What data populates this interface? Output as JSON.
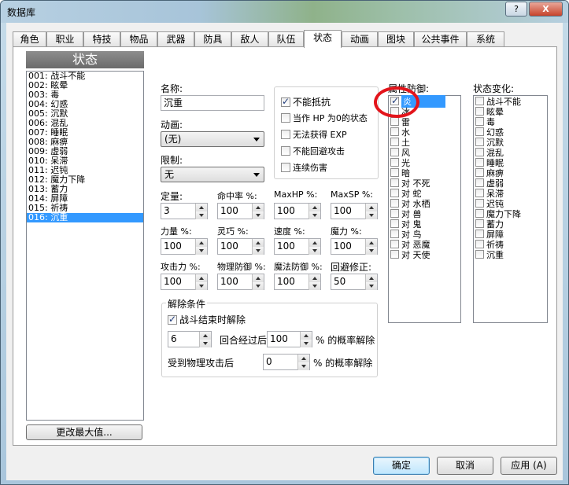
{
  "window": {
    "title": "数据库",
    "help_label": "?",
    "close_label": "X"
  },
  "tabs": [
    "角色",
    "职业",
    "特技",
    "物品",
    "武器",
    "防具",
    "敌人",
    "队伍",
    "状态",
    "动画",
    "图块",
    "公共事件",
    "系统"
  ],
  "active_tab": "状态",
  "left": {
    "header": "状态",
    "items": [
      "001: 战斗不能",
      "002: 眩晕",
      "003: 毒",
      "004: 幻惑",
      "005: 沉默",
      "006: 混乱",
      "007: 睡眠",
      "008: 麻痹",
      "009: 虚弱",
      "010: 呆滞",
      "011: 迟钝",
      "012: 魔力下降",
      "013: 蓄力",
      "014: 屏障",
      "015: 祈祷",
      "016: 沉重"
    ],
    "selected_index": 15,
    "change_max_label": "更改最大值..."
  },
  "form": {
    "name_label": "名称:",
    "name_value": "沉重",
    "animation_label": "动画:",
    "animation_value": "(无)",
    "restriction_label": "限制:",
    "restriction_value": "无",
    "fields": [
      {
        "label": "定量:",
        "value": "3"
      },
      {
        "label": "命中率 %:",
        "value": "100"
      },
      {
        "label": "MaxHP %:",
        "value": "100"
      },
      {
        "label": "MaxSP %:",
        "value": "100"
      },
      {
        "label": "力量 %:",
        "value": "100"
      },
      {
        "label": "灵巧 %:",
        "value": "100"
      },
      {
        "label": "速度 %:",
        "value": "100"
      },
      {
        "label": "魔力 %:",
        "value": "100"
      },
      {
        "label": "攻击力 %:",
        "value": "100"
      },
      {
        "label": "物理防御 %:",
        "value": "100"
      },
      {
        "label": "魔法防御 %:",
        "value": "100"
      },
      {
        "label": "回避修正:",
        "value": "50"
      }
    ],
    "options": [
      {
        "label": "不能抵抗",
        "checked": true
      },
      {
        "label": "当作 HP 为0的状态",
        "checked": false
      },
      {
        "label": "无法获得 EXP",
        "checked": false
      },
      {
        "label": "不能回避攻击",
        "checked": false
      },
      {
        "label": "连续伤害",
        "checked": false
      }
    ],
    "release": {
      "title": "解除条件",
      "battle_end_label": "战斗结束时解除",
      "battle_end_checked": true,
      "turns_value": "6",
      "turns_text": "回合经过后",
      "turns_prob": "100",
      "prob_text": "% 的概率解除",
      "phys_text": "受到物理攻击后",
      "phys_prob": "0",
      "phys_prob_text": "% 的概率解除"
    }
  },
  "element_defense": {
    "label": "属性防御:",
    "items": [
      "炎",
      "冰",
      "雷",
      "水",
      "土",
      "风",
      "光",
      "暗",
      "对 不死",
      "对 蛇",
      "对 水栖",
      "对 兽",
      "对 鬼",
      "对 鸟",
      "对 恶魔",
      "对 天使"
    ],
    "checked": [
      true,
      false,
      false,
      false,
      false,
      false,
      false,
      false,
      false,
      false,
      false,
      false,
      false,
      false,
      false,
      false
    ],
    "selected_index": 0
  },
  "state_change": {
    "label": "状态变化:",
    "items": [
      "战斗不能",
      "眩晕",
      "毒",
      "幻惑",
      "沉默",
      "混乱",
      "睡眠",
      "麻痹",
      "虚弱",
      "呆滞",
      "迟钝",
      "魔力下降",
      "蓄力",
      "屏障",
      "祈祷",
      "沉重"
    ]
  },
  "buttons": {
    "ok": "确定",
    "cancel": "取消",
    "apply": "应用 (A)"
  },
  "colors": {
    "selection": "#3399ff",
    "highlight_circle": "#e3141b"
  }
}
